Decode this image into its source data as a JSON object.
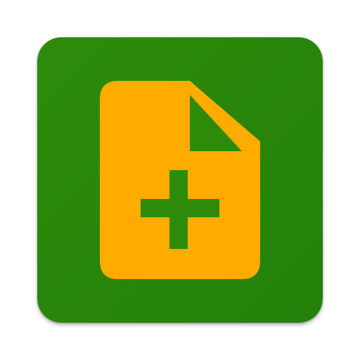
{
  "app_icon": {
    "name": "new-file-icon",
    "colors": {
      "background": "#2E8B0A",
      "background_dark": "#23800A",
      "document": "#FFAB00",
      "plus": "#2E8B0A",
      "corner_fold": "#2E8B0A"
    },
    "glyphs": [
      "file-icon",
      "plus-icon"
    ]
  }
}
